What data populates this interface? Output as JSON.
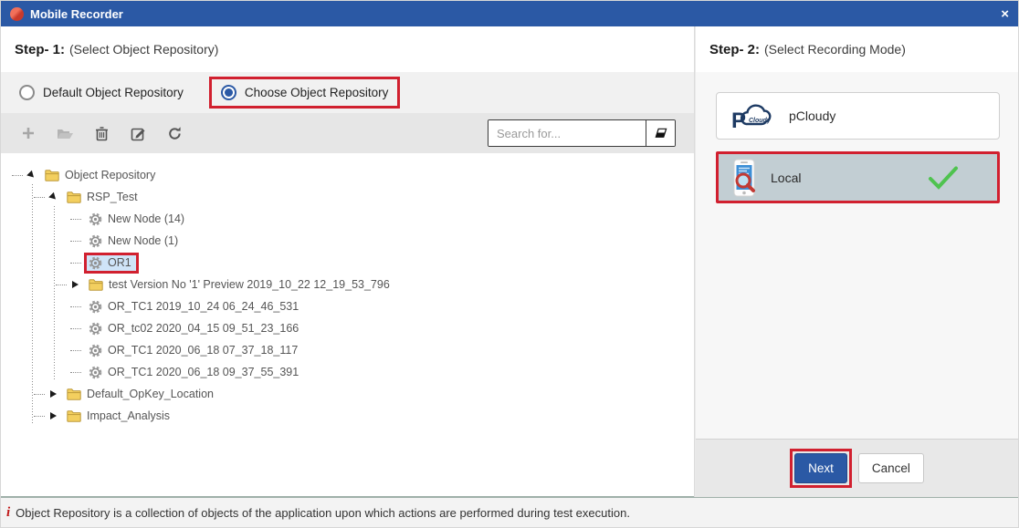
{
  "window": {
    "title": "Mobile Recorder",
    "close_glyph": "×"
  },
  "step1": {
    "title_bold": "Step- 1:",
    "title_rest": "(Select Object Repository)",
    "radios": [
      {
        "label": "Default Object Repository",
        "selected": false,
        "highlighted": false
      },
      {
        "label": "Choose Object Repository",
        "selected": true,
        "highlighted": true
      }
    ],
    "toolbar_icons": [
      "add",
      "open-folder",
      "delete",
      "edit",
      "refresh"
    ],
    "search": {
      "placeholder": "Search for...",
      "value": "",
      "clear_icon": "eraser"
    },
    "tree": [
      {
        "label": "Object Repository",
        "level": 0,
        "icon": "folder",
        "arrow": "expanded",
        "selected": false
      },
      {
        "label": "RSP_Test",
        "level": 1,
        "icon": "folder",
        "arrow": "expanded",
        "selected": false
      },
      {
        "label": "New Node (14)",
        "level": 2,
        "icon": "gear",
        "arrow": null,
        "selected": false
      },
      {
        "label": "New Node (1)",
        "level": 2,
        "icon": "gear",
        "arrow": null,
        "selected": false
      },
      {
        "label": "OR1",
        "level": 2,
        "icon": "gear",
        "arrow": null,
        "selected": true
      },
      {
        "label": "test Version No '1' Preview 2019_10_22 12_19_53_796",
        "level": 2,
        "icon": "folder",
        "arrow": "collapsed",
        "selected": false
      },
      {
        "label": "OR_TC1 2019_10_24 06_24_46_531",
        "level": 2,
        "icon": "gear",
        "arrow": null,
        "selected": false
      },
      {
        "label": "OR_tc02 2020_04_15 09_51_23_166",
        "level": 2,
        "icon": "gear",
        "arrow": null,
        "selected": false
      },
      {
        "label": "OR_TC1 2020_06_18 07_37_18_117",
        "level": 2,
        "icon": "gear",
        "arrow": null,
        "selected": false
      },
      {
        "label": "OR_TC1 2020_06_18 09_37_55_391",
        "level": 2,
        "icon": "gear",
        "arrow": null,
        "selected": false
      },
      {
        "label": "Default_OpKey_Location",
        "level": 1,
        "icon": "folder",
        "arrow": "collapsed",
        "selected": false
      },
      {
        "label": "Impact_Analysis",
        "level": 1,
        "icon": "folder",
        "arrow": "collapsed",
        "selected": false
      }
    ]
  },
  "step2": {
    "title_bold": "Step- 2:",
    "title_rest": "(Select Recording Mode)",
    "modes": [
      {
        "label": "pCloudy",
        "icon": "pcloudy-logo",
        "selected": false
      },
      {
        "label": "Local",
        "icon": "local-device",
        "selected": true
      }
    ],
    "buttons": {
      "next": "Next",
      "cancel": "Cancel"
    }
  },
  "footer": {
    "info_glyph": "i",
    "text": "Object Repository is a collection of objects of the application upon which actions are performed during test execution."
  },
  "colors": {
    "titlebar_blue": "#2b59a5",
    "highlight_red": "#d1202f",
    "selected_tree_bg": "#cfe4f8",
    "local_card_bg": "#c2ced3",
    "check_green": "#4fc34f",
    "folder_yellow": "#f3cf5f"
  }
}
